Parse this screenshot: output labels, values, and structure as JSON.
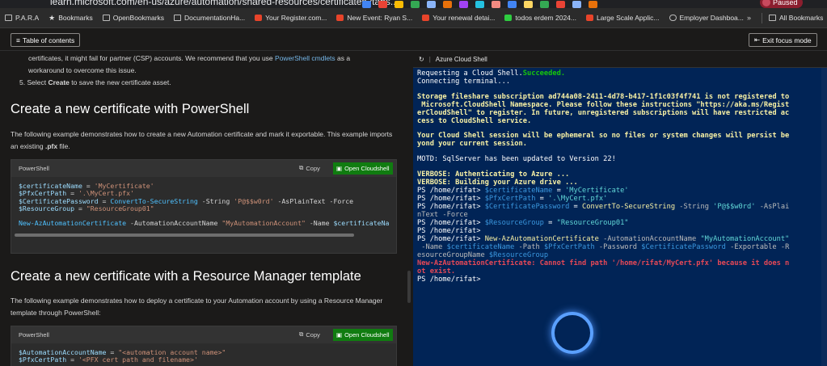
{
  "browser": {
    "url": "learn.microsoft.com/en-us/azure/automation/shared-resources/certificates?tabs..."
  },
  "bookmarks": [
    {
      "label": "P.A.R.A",
      "icon": "folder-icon"
    },
    {
      "label": "Bookmarks",
      "icon": "star-icon"
    },
    {
      "label": "OpenBookmarks",
      "icon": "folder-icon"
    },
    {
      "label": "DocumentationHa...",
      "icon": "folder-icon"
    },
    {
      "label": "Your Register.com...",
      "icon": "gmail-icon"
    },
    {
      "label": "New Event: Ryan S...",
      "icon": "gmail-icon"
    },
    {
      "label": "Your renewal detai...",
      "icon": "gmail-icon"
    },
    {
      "label": "todos erdem 2024...",
      "icon": "sheets-icon"
    },
    {
      "label": "Large Scale Applic...",
      "icon": "gmail-icon"
    },
    {
      "label": "Employer Dashboa...",
      "icon": "globe-icon"
    }
  ],
  "bookmarks_more": "»",
  "bookmarks_all": "All Bookmarks",
  "profile": {
    "label": "Paused"
  },
  "toolbar": {
    "toc_label": "Table of contents",
    "exit_label": "Exit focus mode"
  },
  "doc": {
    "intro_line1_a": "certificates, it might fail for partner (CSP) accounts. We recommend that you use ",
    "intro_link": "PowerShell cmdlets",
    "intro_line1_b": " as a",
    "intro_line2": "workaround to overcome this issue.",
    "step5_a": "5. Select ",
    "step5_b": "Create",
    "step5_c": " to save the new certificate asset.",
    "h_powershell": "Create a new certificate with PowerShell",
    "ps_para_a": "The following example demonstrates how to create a new Automation certificate and mark it exportable. This example imports an existing ",
    "ps_para_b": ".pfx",
    "ps_para_c": " file.",
    "code1_lang": "PowerShell",
    "code_copy": "Copy",
    "code_cloudshell": "Open Cloudshell",
    "h_arm": "Create a new certificate with a Resource Manager template",
    "arm_para": "The following example demonstrates how to deploy a certificate to your Automation account by using a Resource Manager template through PowerShell:",
    "code2_lang": "PowerShell"
  },
  "code1": [
    [
      [
        "c-var",
        "$certificateName"
      ],
      [
        "c-par",
        " = "
      ],
      [
        "c-str",
        "'MyCertificate'"
      ]
    ],
    [
      [
        "c-var",
        "$PfxCertPath"
      ],
      [
        "c-par",
        " = "
      ],
      [
        "c-str",
        "'.\\MyCert.pfx'"
      ]
    ],
    [
      [
        "c-var",
        "$CertificatePassword"
      ],
      [
        "c-par",
        " = "
      ],
      [
        "c-cmd",
        "ConvertTo-SecureString"
      ],
      [
        "c-par",
        " -String "
      ],
      [
        "c-str",
        "'P@$$w0rd'"
      ],
      [
        "c-par",
        " -AsPlainText -Force"
      ]
    ],
    [
      [
        "c-var",
        "$ResourceGroup"
      ],
      [
        "c-par",
        " = "
      ],
      [
        "c-str",
        "\"ResourceGroup01\""
      ]
    ],
    [
      [
        "c-par",
        ""
      ]
    ],
    [
      [
        "c-cmd",
        "New-AzAutomationCertificate"
      ],
      [
        "c-par",
        " -AutomationAccountName "
      ],
      [
        "c-str",
        "\"MyAutomationAccount\""
      ],
      [
        "c-par",
        " -Name "
      ],
      [
        "c-var",
        "$certificateNa"
      ]
    ]
  ],
  "code2": [
    [
      [
        "c-var",
        "$AutomationAccountName"
      ],
      [
        "c-par",
        " = "
      ],
      [
        "c-str",
        "\"<automation account name>\""
      ]
    ],
    [
      [
        "c-var",
        "$PfxCertPath"
      ],
      [
        "c-par",
        " = "
      ],
      [
        "c-str",
        "'<PFX cert path and filename>'"
      ]
    ]
  ],
  "shell": {
    "title": "Azure Cloud Shell"
  },
  "terminal": [
    [
      [
        "t-wh",
        "Requesting a Cloud Shell."
      ],
      [
        "t-ok",
        "Succeeded."
      ]
    ],
    [
      [
        "t-wh",
        "Connecting terminal..."
      ]
    ],
    [
      [
        "t-wh",
        ""
      ]
    ],
    [
      [
        "t-warn",
        "Storage fileshare subscription ad744a08-2411-4d78-b417-1f1c03f4f741 is not registered to"
      ]
    ],
    [
      [
        "t-warn",
        " Microsoft.CloudShell Namespace. Please follow these instructions \"https://aka.ms/Regist"
      ]
    ],
    [
      [
        "t-warn",
        "erCloudShell\" to register. In future, unregistered subscriptions will have restricted ac"
      ]
    ],
    [
      [
        "t-warn",
        "cess to CloudShell service."
      ]
    ],
    [
      [
        "t-wh",
        ""
      ]
    ],
    [
      [
        "t-warn",
        "Your Cloud Shell session will be ephemeral so no files or system changes will persist be"
      ]
    ],
    [
      [
        "t-warn",
        "yond your current session."
      ]
    ],
    [
      [
        "t-wh",
        ""
      ]
    ],
    [
      [
        "t-wh",
        "MOTD: SqlServer has been updated to Version 22!"
      ]
    ],
    [
      [
        "t-wh",
        ""
      ]
    ],
    [
      [
        "t-warn",
        "VERBOSE: Authenticating to Azure ..."
      ]
    ],
    [
      [
        "t-warn",
        "VERBOSE: Building your Azure drive ..."
      ]
    ],
    [
      [
        "t-wh",
        "PS /home/rifat> "
      ],
      [
        "t-var",
        "$certificateName"
      ],
      [
        "t-wh",
        " = "
      ],
      [
        "t-str",
        "'MyCertificate'"
      ]
    ],
    [
      [
        "t-wh",
        "PS /home/rifat> "
      ],
      [
        "t-var",
        "$PfxCertPath"
      ],
      [
        "t-wh",
        " = "
      ],
      [
        "t-str",
        "'.\\MyCert.pfx'"
      ]
    ],
    [
      [
        "t-wh",
        "PS /home/rifat> "
      ],
      [
        "t-var",
        "$CertificatePassword"
      ],
      [
        "t-wh",
        " = "
      ],
      [
        "t-cmd",
        "ConvertTo-SecureString"
      ],
      [
        "t-par",
        " -String "
      ],
      [
        "t-str",
        "'P@$$w0rd'"
      ],
      [
        "t-par",
        " -AsPlai"
      ]
    ],
    [
      [
        "t-par",
        "nText -Force"
      ]
    ],
    [
      [
        "t-wh",
        "PS /home/rifat> "
      ],
      [
        "t-var",
        "$ResourceGroup"
      ],
      [
        "t-wh",
        " = "
      ],
      [
        "t-str",
        "\"ResourceGroup01\""
      ]
    ],
    [
      [
        "t-wh",
        "PS /home/rifat>"
      ]
    ],
    [
      [
        "t-wh",
        "PS /home/rifat> "
      ],
      [
        "t-cmd",
        "New-AzAutomationCertificate"
      ],
      [
        "t-par",
        " -AutomationAccountName "
      ],
      [
        "t-str",
        "\"MyAutomationAccount\""
      ]
    ],
    [
      [
        "t-par",
        " -Name "
      ],
      [
        "t-var",
        "$certificateName"
      ],
      [
        "t-par",
        " -Path "
      ],
      [
        "t-var",
        "$PfxCertPath"
      ],
      [
        "t-par",
        " -Password "
      ],
      [
        "t-var",
        "$CertificatePassword"
      ],
      [
        "t-par",
        " -Exportable -R"
      ]
    ],
    [
      [
        "t-par",
        "esourceGroupName "
      ],
      [
        "t-var",
        "$ResourceGroup"
      ]
    ],
    [
      [
        "t-err",
        "New-AzAutomationCertificate: Cannot find path '/home/rifat/MyCert.pfx' because it does n"
      ]
    ],
    [
      [
        "t-err",
        "ot exist."
      ]
    ],
    [
      [
        "t-wh",
        "PS /home/rifat> "
      ]
    ]
  ],
  "colors": {
    "shell_bg": "#012456",
    "cloudshell_button": "#107c10",
    "page_bg": "#1b1a19"
  }
}
